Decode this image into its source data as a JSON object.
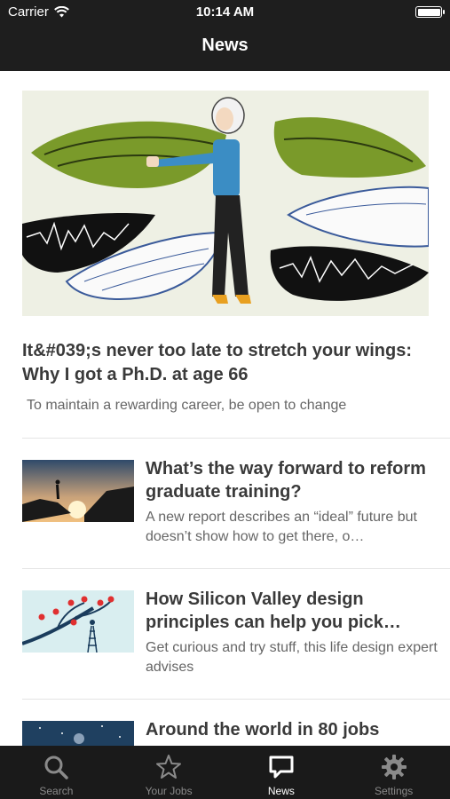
{
  "status": {
    "carrier": "Carrier",
    "time": "10:14 AM"
  },
  "nav": {
    "title": "News"
  },
  "featured": {
    "title": "It&#039;s never too late to stretch your wings: Why I got a Ph.D. at age 66",
    "subtitle": "To maintain a rewarding career, be open to change",
    "image_icon": "illustration-woman-with-wings"
  },
  "articles": [
    {
      "title": "What’s the way forward to reform graduate training?",
      "description": "A new report describes an “ideal” future but doesn’t show how to get there, o…",
      "image_icon": "photo-hiker-at-sunset"
    },
    {
      "title": "How Silicon Valley design principles can help you pick…",
      "description": "Get curious and try stuff, this life design expert advises",
      "image_icon": "illustration-tree-ladder"
    },
    {
      "title": "Around the world in 80 jobs",
      "description": "",
      "image_icon": "photo-night-sky"
    }
  ],
  "tabs": [
    {
      "label": "Search",
      "icon": "search-icon",
      "active": false
    },
    {
      "label": "Your Jobs",
      "icon": "star-icon",
      "active": false
    },
    {
      "label": "News",
      "icon": "chat-bubble-icon",
      "active": true
    },
    {
      "label": "Settings",
      "icon": "gear-icon",
      "active": false
    }
  ],
  "colors": {
    "bar": "#1e1e1e",
    "tabbar": "#1a1a1a",
    "tab_active": "#ffffff",
    "tab_inactive": "#8a8a8a"
  }
}
